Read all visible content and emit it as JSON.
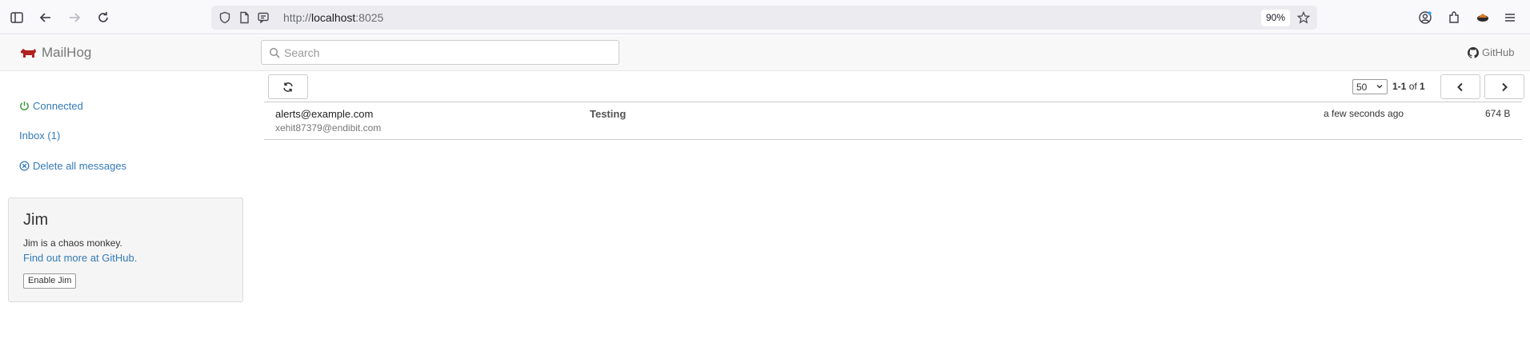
{
  "browser": {
    "url_scheme": "http://",
    "url_host": "localhost",
    "url_port": ":8025",
    "zoom": "90%"
  },
  "navbar": {
    "brand": "MailHog",
    "search_placeholder": "Search",
    "github_label": "GitHub"
  },
  "sidebar": {
    "connected": "Connected",
    "inbox": "Inbox (1)",
    "delete_all": "Delete all messages"
  },
  "jim": {
    "title": "Jim",
    "description": "Jim is a chaos monkey.",
    "link": "Find out more at GitHub.",
    "button": "Enable Jim"
  },
  "toolbar": {
    "per_page": "50",
    "range": "1-1",
    "of_label": "of",
    "total": "1"
  },
  "messages": [
    {
      "from": "alerts@example.com",
      "to": "xehit87379@endibit.com",
      "subject": "Testing",
      "time": "a few seconds ago",
      "size": "674 B"
    }
  ],
  "colors": {
    "link": "#337ab7",
    "connected": "#3c9a3c",
    "brand_logo": "#b22222"
  }
}
